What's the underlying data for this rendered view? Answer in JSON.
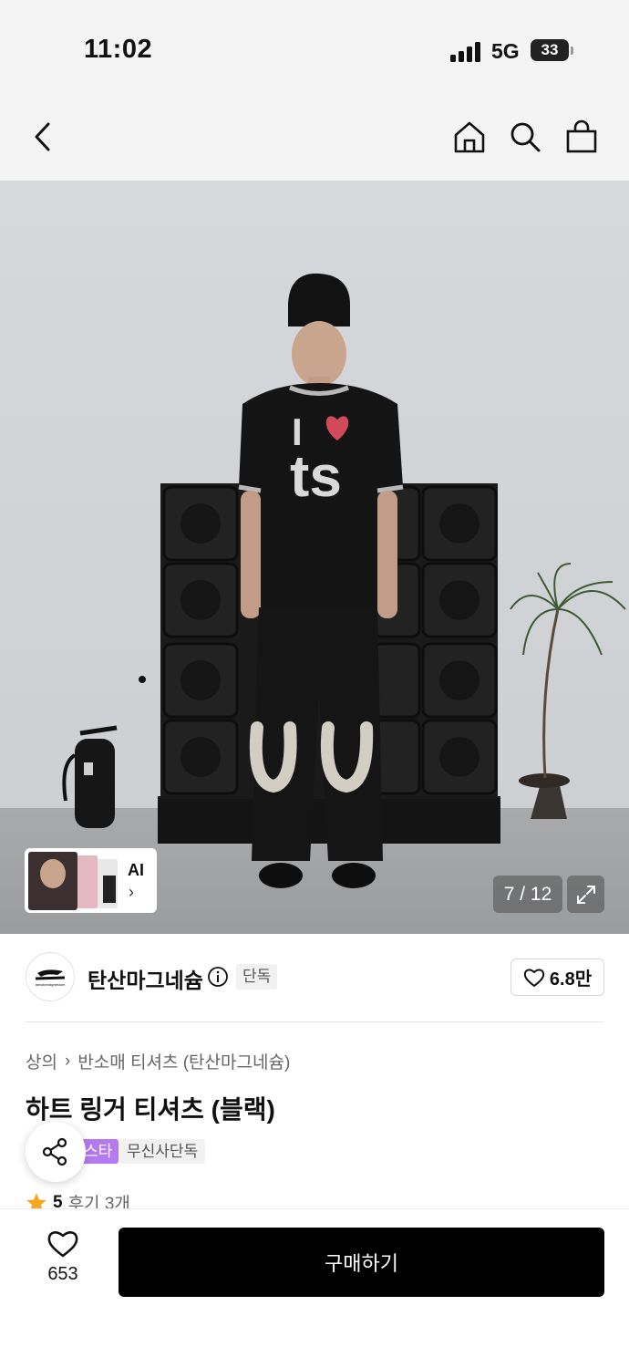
{
  "status_bar": {
    "time": "11:02",
    "network": "5G",
    "battery": "33"
  },
  "nav": {
    "back_icon": "chevron-left-icon",
    "home_icon": "home-icon",
    "search_icon": "search-icon",
    "cart_icon": "shopping-bag-icon"
  },
  "gallery": {
    "counter": "7 / 12",
    "ai_label": "AI",
    "ai_arrow": "›",
    "expand_icon": "expand-icon",
    "shirt_print_top": "I",
    "shirt_print_bottom": "ts"
  },
  "brand": {
    "name": "탄산마그네슘",
    "tag": "단독",
    "likes": "6.8만",
    "logo_caption": "tansanmagnesium"
  },
  "breadcrumb": {
    "category": "상의",
    "separator": "›",
    "subcategory": "반소매 티셔츠 (탄산마그네슘)"
  },
  "product": {
    "title": "하트 링거 티셔츠 (블랙)",
    "tags": [
      "스타",
      "무신사단독"
    ],
    "rating": "5",
    "reviews": "후기 3개"
  },
  "bottom": {
    "wish_count": "653",
    "buy_label": "구매하기"
  },
  "colors": {
    "accent_purple": "#b57af0",
    "rating_star": "#f5a623",
    "buy_button": "#000000"
  }
}
